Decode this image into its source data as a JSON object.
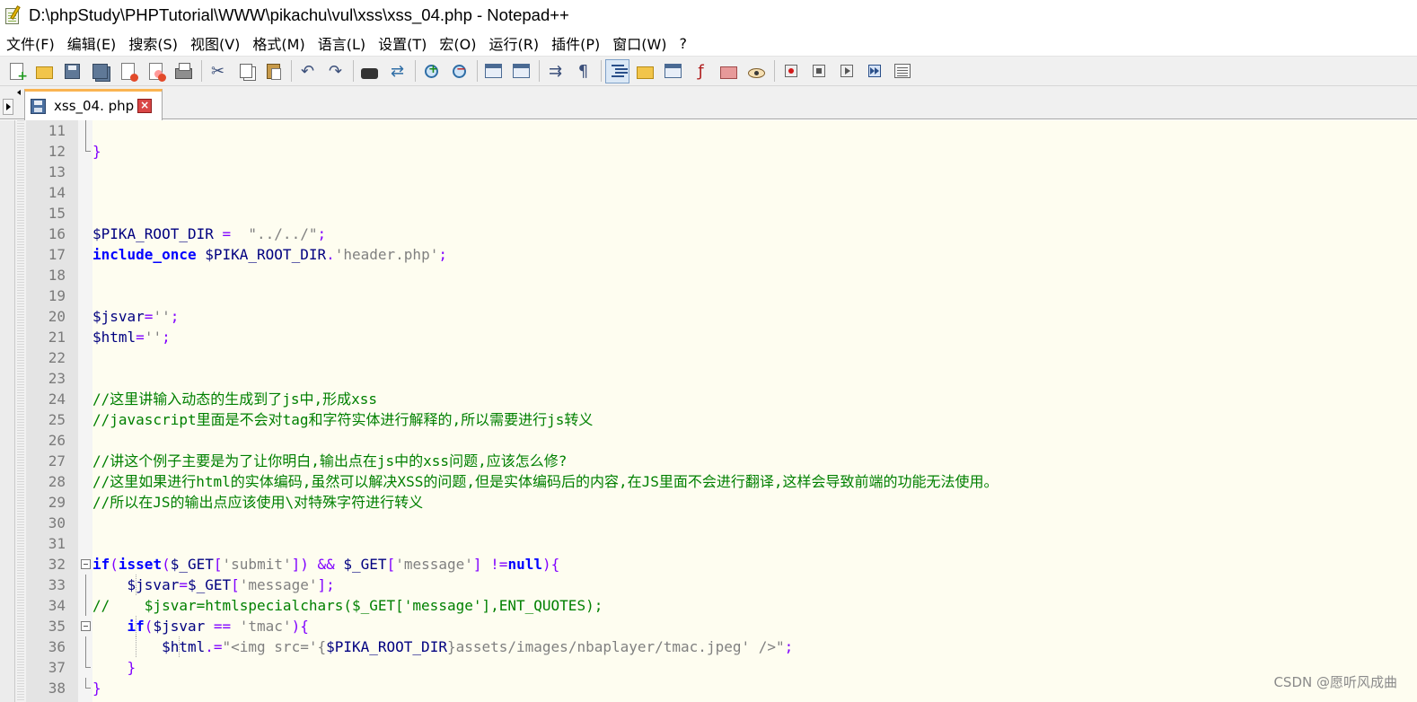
{
  "window": {
    "title": "D:\\phpStudy\\PHPTutorial\\WWW\\pikachu\\vul\\xss\\xss_04.php - Notepad++"
  },
  "menu": [
    "文件(F)",
    "编辑(E)",
    "搜索(S)",
    "视图(V)",
    "格式(M)",
    "语言(L)",
    "设置(T)",
    "宏(O)",
    "运行(R)",
    "插件(P)",
    "窗口(W)",
    "?"
  ],
  "toolbar": {
    "buttons": [
      "new-file-icon",
      "open-folder-icon",
      "save-icon",
      "save-all-icon",
      "close-icon",
      "close-all-icon",
      "print-icon",
      "cut-icon",
      "copy-icon",
      "paste-icon",
      "undo-icon",
      "redo-icon",
      "find-icon",
      "replace-icon",
      "zoom-in-icon",
      "zoom-out-icon",
      "sync-vertical-icon",
      "sync-horizontal-icon",
      "word-wrap-icon",
      "show-all-chars-icon",
      "indent-guide-icon",
      "language-icon",
      "document-map-icon",
      "function-list-icon",
      "folder-workspace-icon",
      "monitoring-icon",
      "record-macro-icon",
      "stop-macro-icon",
      "play-macro-icon",
      "run-macro-multiple-icon",
      "save-macro-icon"
    ],
    "active_button": "indent-guide-icon"
  },
  "tabs": [
    {
      "label": "xss_04. php",
      "active": true
    }
  ],
  "editor": {
    "colors": {
      "background": "#fefdf0",
      "keyword": "#0000ff",
      "variable": "#000080",
      "string": "#808080",
      "operator": "#8000ff",
      "comment": "#008000",
      "default": "#000000"
    },
    "lines": [
      {
        "n": "11",
        "fold": "line",
        "tokens": []
      },
      {
        "n": "12",
        "fold": "end",
        "tokens": [
          {
            "t": "}",
            "c": "operator"
          }
        ]
      },
      {
        "n": "13",
        "fold": "",
        "tokens": []
      },
      {
        "n": "14",
        "fold": "",
        "tokens": []
      },
      {
        "n": "15",
        "fold": "",
        "tokens": []
      },
      {
        "n": "16",
        "fold": "",
        "tokens": [
          {
            "t": "$PIKA_ROOT_DIR",
            "c": "variable"
          },
          {
            "t": " = ",
            "c": "operator"
          },
          {
            "t": " \"../../\"",
            "c": "string"
          },
          {
            "t": ";",
            "c": "operator"
          }
        ]
      },
      {
        "n": "17",
        "fold": "",
        "tokens": [
          {
            "t": "include_once",
            "c": "keyword_b"
          },
          {
            "t": " ",
            "c": "default"
          },
          {
            "t": "$PIKA_ROOT_DIR",
            "c": "variable"
          },
          {
            "t": ".",
            "c": "operator"
          },
          {
            "t": "'header.php'",
            "c": "string"
          },
          {
            "t": ";",
            "c": "operator"
          }
        ]
      },
      {
        "n": "18",
        "fold": "",
        "tokens": []
      },
      {
        "n": "19",
        "fold": "",
        "tokens": []
      },
      {
        "n": "20",
        "fold": "",
        "tokens": [
          {
            "t": "$jsvar",
            "c": "variable"
          },
          {
            "t": "=",
            "c": "operator"
          },
          {
            "t": "''",
            "c": "string"
          },
          {
            "t": ";",
            "c": "operator"
          }
        ]
      },
      {
        "n": "21",
        "fold": "",
        "tokens": [
          {
            "t": "$html",
            "c": "variable"
          },
          {
            "t": "=",
            "c": "operator"
          },
          {
            "t": "''",
            "c": "string"
          },
          {
            "t": ";",
            "c": "operator"
          }
        ]
      },
      {
        "n": "22",
        "fold": "",
        "tokens": []
      },
      {
        "n": "23",
        "fold": "",
        "tokens": []
      },
      {
        "n": "24",
        "fold": "",
        "tokens": [
          {
            "t": "//这里讲输入动态的生成到了js中,形成xss",
            "c": "comment"
          }
        ]
      },
      {
        "n": "25",
        "fold": "",
        "tokens": [
          {
            "t": "//javascript里面是不会对tag和字符实体进行解释的,所以需要进行js转义",
            "c": "comment"
          }
        ]
      },
      {
        "n": "26",
        "fold": "",
        "tokens": []
      },
      {
        "n": "27",
        "fold": "",
        "tokens": [
          {
            "t": "//讲这个例子主要是为了让你明白,输出点在js中的xss问题,应该怎么修?",
            "c": "comment"
          }
        ]
      },
      {
        "n": "28",
        "fold": "",
        "tokens": [
          {
            "t": "//这里如果进行html的实体编码,虽然可以解决XSS的问题,但是实体编码后的内容,在JS里面不会进行翻译,这样会导致前端的功能无法使用。",
            "c": "comment"
          }
        ]
      },
      {
        "n": "29",
        "fold": "",
        "tokens": [
          {
            "t": "//所以在JS的输出点应该使用\\对特殊字符进行转义",
            "c": "comment"
          }
        ]
      },
      {
        "n": "30",
        "fold": "",
        "tokens": []
      },
      {
        "n": "31",
        "fold": "",
        "tokens": []
      },
      {
        "n": "32",
        "fold": "box",
        "tokens": [
          {
            "t": "if",
            "c": "keyword_b"
          },
          {
            "t": "(",
            "c": "operator"
          },
          {
            "t": "isset",
            "c": "keyword_b"
          },
          {
            "t": "(",
            "c": "operator"
          },
          {
            "t": "$_GET",
            "c": "variable"
          },
          {
            "t": "[",
            "c": "operator"
          },
          {
            "t": "'submit'",
            "c": "string"
          },
          {
            "t": "]) && ",
            "c": "operator"
          },
          {
            "t": "$_GET",
            "c": "variable"
          },
          {
            "t": "[",
            "c": "operator"
          },
          {
            "t": "'message'",
            "c": "string"
          },
          {
            "t": "] !=",
            "c": "operator"
          },
          {
            "t": "null",
            "c": "keyword_b"
          },
          {
            "t": "){",
            "c": "operator"
          }
        ]
      },
      {
        "n": "33",
        "fold": "line",
        "tokens": [
          {
            "t": "    ",
            "c": "default"
          },
          {
            "t": "$jsvar",
            "c": "variable"
          },
          {
            "t": "=",
            "c": "operator"
          },
          {
            "t": "$_GET",
            "c": "variable"
          },
          {
            "t": "[",
            "c": "operator"
          },
          {
            "t": "'message'",
            "c": "string"
          },
          {
            "t": "];",
            "c": "operator"
          }
        ]
      },
      {
        "n": "34",
        "fold": "line",
        "tokens": [
          {
            "t": "//    $jsvar=htmlspecialchars($_GET['message'],ENT_QUOTES);",
            "c": "comment_dark"
          }
        ]
      },
      {
        "n": "35",
        "fold": "box",
        "tokens": [
          {
            "t": "    ",
            "c": "default"
          },
          {
            "t": "if",
            "c": "keyword_b"
          },
          {
            "t": "(",
            "c": "operator"
          },
          {
            "t": "$jsvar",
            "c": "variable"
          },
          {
            "t": " == ",
            "c": "operator"
          },
          {
            "t": "'tmac'",
            "c": "string"
          },
          {
            "t": "){",
            "c": "operator"
          }
        ]
      },
      {
        "n": "36",
        "fold": "line",
        "tokens": [
          {
            "t": "        ",
            "c": "default"
          },
          {
            "t": "$html",
            "c": "variable"
          },
          {
            "t": ".=",
            "c": "operator"
          },
          {
            "t": "\"<img src='{",
            "c": "string"
          },
          {
            "t": "$PIKA_ROOT_DIR",
            "c": "variable"
          },
          {
            "t": "}assets/images/nbaplayer/tmac.jpeg' />\"",
            "c": "string"
          },
          {
            "t": ";",
            "c": "operator"
          }
        ]
      },
      {
        "n": "37",
        "fold": "end",
        "tokens": [
          {
            "t": "    ",
            "c": "default"
          },
          {
            "t": "}",
            "c": "operator"
          }
        ]
      },
      {
        "n": "38",
        "fold": "end",
        "tokens": [
          {
            "t": "}",
            "c": "operator"
          }
        ]
      }
    ]
  },
  "watermark": "CSDN @愿听风成曲"
}
